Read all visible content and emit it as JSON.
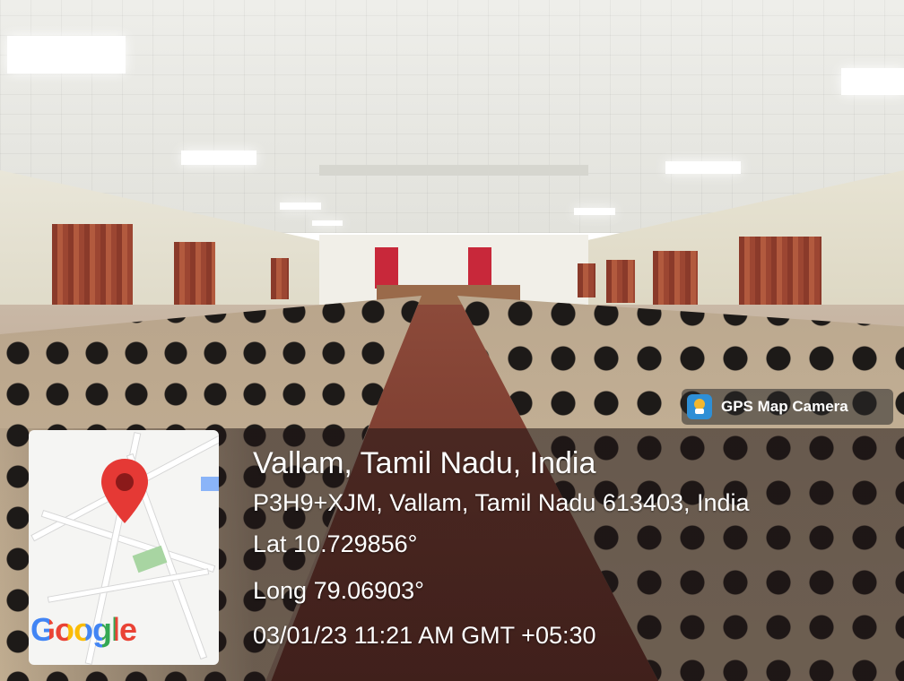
{
  "overlay": {
    "app_name": "GPS Map Camera",
    "place": "Vallam, Tamil Nadu, India",
    "address": "P3H9+XJM, Vallam, Tamil Nadu 613403, India",
    "latitude": "Lat 10.729856°",
    "longitude": "Long 79.06903°",
    "timestamp": "03/01/23 11:21 AM GMT +05:30"
  },
  "map": {
    "brand": "Google",
    "pin_color": "#e53935",
    "brand_colors": [
      "#4285f4",
      "#ea4335",
      "#fbbc05",
      "#4285f4",
      "#34a853",
      "#ea4335"
    ]
  },
  "icons": {
    "badge_icon": "gps-map-camera-icon",
    "map_marker": "location-pin-icon"
  }
}
